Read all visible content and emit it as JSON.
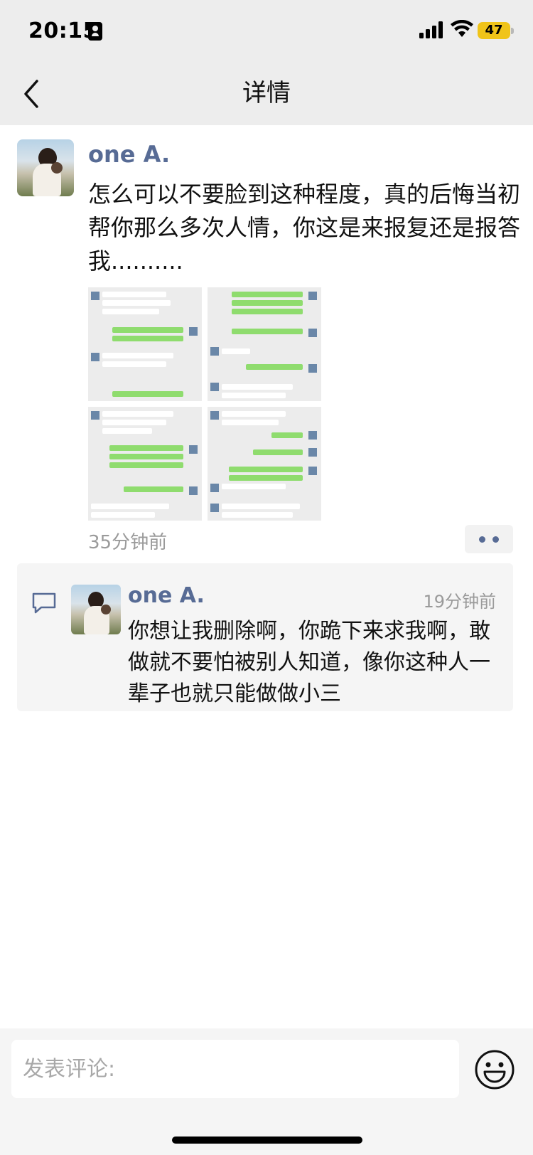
{
  "status_bar": {
    "time": "20:15",
    "battery": "47",
    "battery_color": "#f0c419",
    "icons": [
      "sim-card-icon",
      "signal-icon",
      "wifi-icon",
      "battery-icon"
    ]
  },
  "header": {
    "title": "详情",
    "back_icon": "chevron-left-icon"
  },
  "post": {
    "author": "one A.",
    "text": "怎么可以不要脸到这种程度，真的后悔当初帮你那么多次人情，你这是来报复还是报答我..........",
    "photo_count": 4,
    "time": "35分钟前",
    "more_icon": "more-dots-icon"
  },
  "comment": {
    "author": "one A.",
    "time": "19分钟前",
    "text": "你想让我删除啊，你跪下来求我啊，敢做就不要怕被别人知道，像你这种人一辈子也就只能做做小三",
    "icon": "comment-bubble-icon"
  },
  "input_bar": {
    "placeholder": "发表评论:",
    "value": "",
    "emoji_icon": "emoji-smile-icon"
  },
  "colors": {
    "name_link": "#576b95",
    "meta_gray": "#9a9a9a",
    "header_bg": "#ededed"
  }
}
